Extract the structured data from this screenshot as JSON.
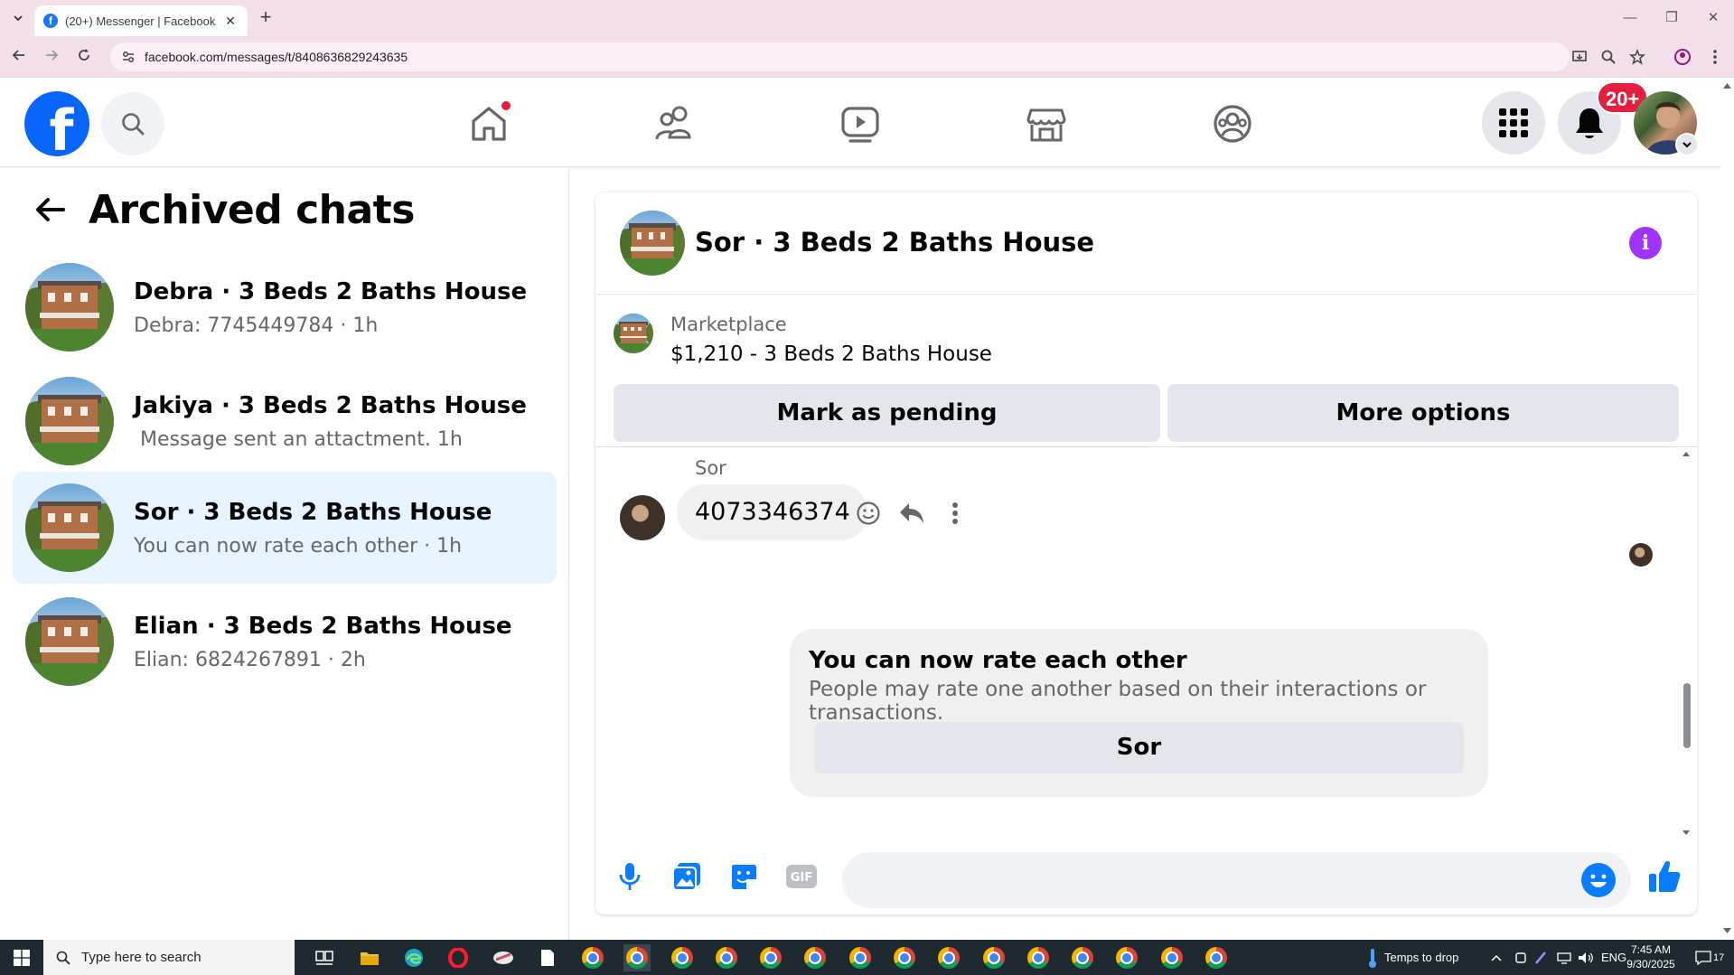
{
  "browser": {
    "tab_title": "(20+) Messenger | Facebook",
    "url": "facebook.com/messages/t/8408636829243635",
    "new_tab": "+",
    "close_tab": "✕"
  },
  "fbnav": {
    "logo_letter": "f",
    "notifications_badge": "20+",
    "brand_color": "#0866ff"
  },
  "archived": {
    "title": "Archived chats",
    "chats": [
      {
        "name": "Debra · 3 Beds 2 Baths House",
        "preview": "Debra: 7745449784 · 1h",
        "active": false
      },
      {
        "name": "Jakiya · 3 Beds 2 Baths House",
        "preview": " Message sent an attactment. 1h",
        "active": false
      },
      {
        "name": "Sor · 3 Beds 2 Baths House",
        "preview": "You can now rate each other · 1h",
        "active": true
      },
      {
        "name": "Elian · 3 Beds 2 Baths House",
        "preview": "Elian: 6824267891 · 2h",
        "active": false
      }
    ]
  },
  "conversation": {
    "title": "Sor · 3 Beds 2 Baths House",
    "marketplace_label": "Marketplace",
    "listing": "$1,210 - 3 Beds 2 Baths House",
    "mark_pending": "Mark as pending",
    "more_options": "More options",
    "sender_name": "Sor",
    "message": "4073346374",
    "rate_title": "You can now rate each other",
    "rate_desc": "People may rate one another based on their interactions or transactions.",
    "rate_button": "Sor",
    "composer_placeholder": "",
    "info_glyph": "i",
    "accent_color": "#0a7cff"
  },
  "taskbar": {
    "search_placeholder": "Type here to search",
    "weather": "Temps to drop",
    "language": "ENG",
    "time": "7:45 AM",
    "date": "9/30/2025",
    "notif_count": "17"
  }
}
